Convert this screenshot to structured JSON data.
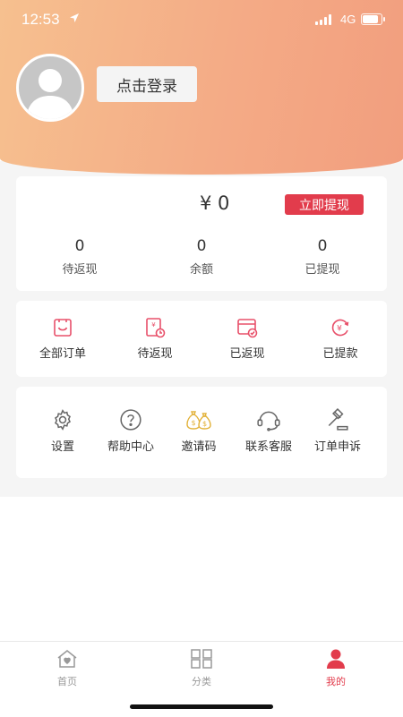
{
  "status_bar": {
    "time": "12:53",
    "network": "4G",
    "battery_level": 0.85
  },
  "header": {
    "login_label": "点击登录"
  },
  "wallet": {
    "balance": "¥ 0",
    "withdraw_label": "立即提现",
    "stats": [
      {
        "value": "0",
        "label": "待返现"
      },
      {
        "value": "0",
        "label": "余额"
      },
      {
        "value": "0",
        "label": "已提现"
      }
    ]
  },
  "orders": {
    "items": [
      {
        "label": "全部订单",
        "icon": "all-orders-icon"
      },
      {
        "label": "待返现",
        "icon": "pending-cashback-icon"
      },
      {
        "label": "已返现",
        "icon": "cashback-done-icon"
      },
      {
        "label": "已提款",
        "icon": "withdrawn-icon"
      }
    ]
  },
  "tools": {
    "items": [
      {
        "label": "设置",
        "icon": "gear-icon"
      },
      {
        "label": "帮助中心",
        "icon": "help-icon"
      },
      {
        "label": "邀请码",
        "icon": "money-bags-icon"
      },
      {
        "label": "联系客服",
        "icon": "headset-icon"
      },
      {
        "label": "订单申诉",
        "icon": "gavel-icon"
      }
    ]
  },
  "tabbar": {
    "items": [
      {
        "label": "首页",
        "icon": "home-icon",
        "active": false
      },
      {
        "label": "分类",
        "icon": "grid-icon",
        "active": false
      },
      {
        "label": "我的",
        "icon": "user-icon",
        "active": true
      }
    ]
  },
  "colors": {
    "accent": "#e23c4c",
    "header_start": "#f6c08f",
    "header_end": "#f29e7e",
    "icon_pink": "#e8506a",
    "icon_gold": "#e2b23a"
  }
}
